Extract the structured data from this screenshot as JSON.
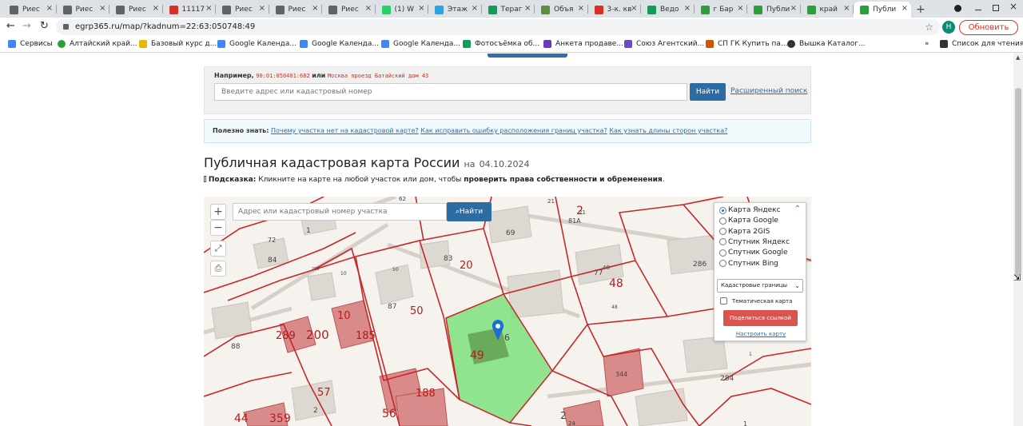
{
  "browser": {
    "tabs": [
      {
        "label": "Риес",
        "icon": "site-icon",
        "color": "#5f6368"
      },
      {
        "label": "Риес",
        "icon": "site-icon",
        "color": "#5f6368"
      },
      {
        "label": "Риес",
        "icon": "site-icon",
        "color": "#5f6368"
      },
      {
        "label": "11117",
        "icon": "avito-icon",
        "color": "#d93025"
      },
      {
        "label": "Риес",
        "icon": "site-icon",
        "color": "#5f6368"
      },
      {
        "label": "Риес",
        "icon": "site-icon",
        "color": "#5f6368"
      },
      {
        "label": "Риес",
        "icon": "site-icon",
        "color": "#5f6368"
      },
      {
        "label": "(1) W",
        "icon": "whatsapp-icon",
        "color": "#25d366"
      },
      {
        "label": "Этаж",
        "icon": "telegram-icon",
        "color": "#2aa3df"
      },
      {
        "label": "Тераг",
        "icon": "sheets-icon",
        "color": "#0f9d58"
      },
      {
        "label": "Объя",
        "icon": "site-icon",
        "color": "#5a8f3c"
      },
      {
        "label": "3-к. кв",
        "icon": "avito-icon",
        "color": "#d93025"
      },
      {
        "label": "Ведо",
        "icon": "sheets-icon",
        "color": "#0f9d58"
      },
      {
        "label": "г Бар",
        "icon": "check-icon",
        "color": "#2e9e3d"
      },
      {
        "label": "Публи",
        "icon": "check-icon",
        "color": "#2e9e3d"
      },
      {
        "label": "край",
        "icon": "check-icon",
        "color": "#2e9e3d"
      },
      {
        "label": "Публи",
        "icon": "check-icon",
        "color": "#2e9e3d"
      }
    ],
    "new_tab": "+",
    "url": "egrp365.ru/map/?kadnum=22:63:050748:49",
    "update_button": "Обновить",
    "profile_initial": "Н"
  },
  "bookmarks": [
    {
      "label": "Сервисы",
      "icon": "apps-icon",
      "color": "#4285f4"
    },
    {
      "label": "Алтайский край...",
      "icon": "check-icon",
      "color": "#2e9e3d"
    },
    {
      "label": "Базовый курс д...",
      "icon": "bookmark-icon",
      "color": "#e6b800"
    },
    {
      "label": "Google Календа...",
      "icon": "calendar-icon",
      "color": "#4285f4"
    },
    {
      "label": "Google Календа...",
      "icon": "calendar-icon",
      "color": "#4285f4"
    },
    {
      "label": "Google Календа...",
      "icon": "calendar-icon",
      "color": "#4285f4"
    },
    {
      "label": "Фотосъёмка об...",
      "icon": "sheets-icon",
      "color": "#0f9d58"
    },
    {
      "label": "Анкета продаве...",
      "icon": "forms-icon",
      "color": "#673ab7"
    },
    {
      "label": "Союз Агентский...",
      "icon": "bookmark-icon",
      "color": "#6a4bc4"
    },
    {
      "label": "СП ГК Купить па...",
      "icon": "bookmark-icon",
      "color": "#d35400"
    },
    {
      "label": "Вышка Каталог...",
      "icon": "globe-icon",
      "color": "#333333"
    },
    {
      "label": "Список для чтения",
      "icon": "reading-list-icon",
      "color": "#333333"
    }
  ],
  "bookmarks_more": "»",
  "search": {
    "example_label": "Например,",
    "example_kadnum": "90:01:050401:682",
    "example_or": "или",
    "example_address": "Москва проезд Батайский дом 43",
    "placeholder": "Введите адрес или кадастровый номер",
    "button": "Найти",
    "advanced_link": "Расширенный поиск"
  },
  "info": {
    "label": "Полезно знать:",
    "links": [
      "Почему участка нет на кадастровой карте?",
      "Как исправить ошибку расположения границ участка?",
      "Как узнать длины сторон участка?"
    ]
  },
  "page": {
    "title": "Публичная кадастровая карта России",
    "date_prefix": "на",
    "date": "04.10.2024",
    "hint_label": "Подсказка:",
    "hint_text": "Кликните на карте на любой участок или дом, чтобы",
    "hint_bold": "проверить права собственности и обременения",
    "hint_end": "."
  },
  "map": {
    "zoom_in": "+",
    "zoom_out": "−",
    "search_placeholder": "Адрес или кадастровый номер участка",
    "search_button": "Найти",
    "layers": [
      {
        "label": "Карта Яндекс",
        "selected": true
      },
      {
        "label": "Карта Google",
        "selected": false
      },
      {
        "label": "Карта 2GIS",
        "selected": false
      },
      {
        "label": "Спутник Яндекс",
        "selected": false
      },
      {
        "label": "Спутник Google",
        "selected": false
      },
      {
        "label": "Спутник Bing",
        "selected": false
      }
    ],
    "overlay_select": "Кадастровые границы",
    "thematic_label": "Тематическая карта",
    "thematic_checked": false,
    "share_button": "Поделиться ссылкой",
    "configure_link": "Настроить карту",
    "parcel_labels": [
      "1",
      "72",
      "84",
      "289",
      "10",
      "50",
      "83",
      "20",
      "69",
      "62",
      "21",
      "2",
      "21",
      "81А",
      "48",
      "77",
      "48",
      "48",
      "286",
      "289",
      "200",
      "88",
      "10",
      "185",
      "87",
      "50",
      "49",
      "6",
      "284",
      "1",
      "57",
      "188",
      "44",
      "359",
      "2",
      "56",
      "24",
      "344",
      "2",
      "1"
    ],
    "colors": {
      "boundary": "#c62828",
      "highlight_fill": "#7ee07e",
      "building_fill": "#d98a8a",
      "label": "#b71c1c"
    }
  }
}
